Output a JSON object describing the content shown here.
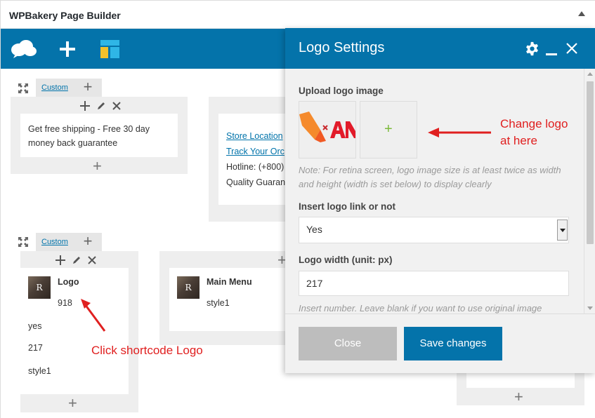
{
  "header": {
    "title": "WPBakery Page Builder"
  },
  "toolbar": {
    "icons": [
      "cloud-icon",
      "add-icon",
      "layout-icon"
    ]
  },
  "rows": [
    {
      "tab_label": "Custom",
      "columns": [
        {
          "text": "Get free shipping  - Free 30 day money back guarantee"
        },
        {
          "links": [
            "Store Location",
            "Track Your Orc"
          ],
          "lines": [
            "Hotline: (+800)",
            "Quality Guaran"
          ]
        }
      ]
    },
    {
      "tab_label": "Custom",
      "columns": [
        {
          "element_title": "Logo",
          "element_value": "918",
          "extra": [
            "yes",
            "217",
            "style1"
          ]
        },
        {
          "element_title": "Main Menu",
          "element_value": "style1"
        }
      ]
    }
  ],
  "annotations": {
    "change_logo": "Change logo\nat here",
    "click_shortcode": "Click shortcode Logo",
    "color": "#e02020"
  },
  "modal": {
    "title": "Logo Settings",
    "upload_label": "Upload logo image",
    "add_symbol": "+",
    "upload_note": "Note: For retina screen, logo image size is at least twice as width and height (width is set below) to display clearly",
    "link_label": "Insert logo link or not",
    "link_value": "Yes",
    "width_label": "Logo width (unit: px)",
    "width_value": "217",
    "width_note": "Insert number. Leave blank if you want to use original image",
    "close_label": "Close",
    "save_label": "Save changes"
  },
  "colors": {
    "brand": "#0473aa",
    "save": "#0473aa",
    "close": "#bdbdbd"
  }
}
